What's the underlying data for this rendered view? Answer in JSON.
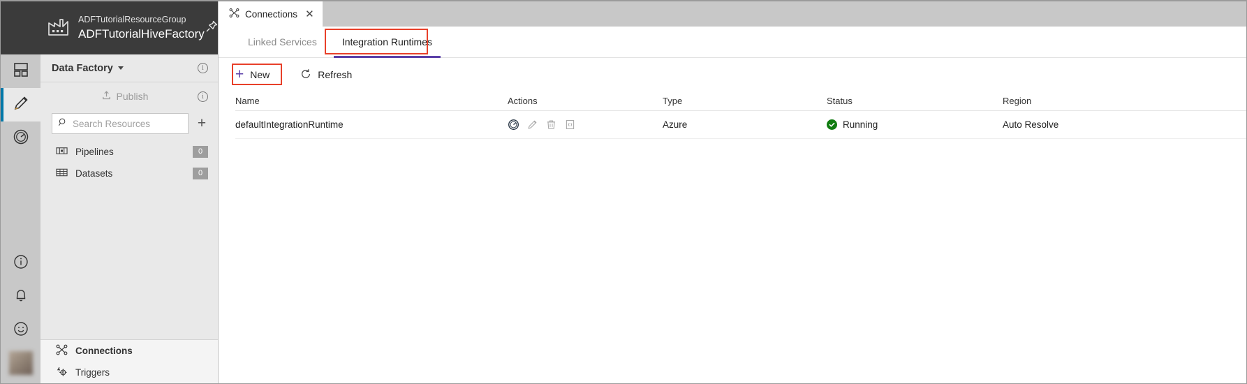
{
  "factory": {
    "resource_group": "ADFTutorialResourceGroup",
    "name": "ADFTutorialHiveFactory",
    "icon": "factory-icon",
    "pin_icon": "pin-icon"
  },
  "left_panel": {
    "title": "Data Factory",
    "title_info_icon": "info-icon",
    "publish_label": "Publish",
    "publish_icon": "upload-icon",
    "publish_info_icon": "info-icon",
    "search": {
      "placeholder": "Search Resources",
      "value": "",
      "icon": "search-icon"
    },
    "add_icon": "plus-icon",
    "items": [
      {
        "label": "Pipelines",
        "count": "0",
        "icon": "pipeline-icon"
      },
      {
        "label": "Datasets",
        "count": "0",
        "icon": "table-icon"
      }
    ],
    "bottom_items": [
      {
        "label": "Connections",
        "icon": "connections-icon",
        "selected": true
      },
      {
        "label": "Triggers",
        "icon": "trigger-icon",
        "selected": false
      }
    ]
  },
  "rail": {
    "items": [
      {
        "name": "home-icon"
      },
      {
        "name": "edit-pencil-icon"
      },
      {
        "name": "monitor-gauge-icon"
      }
    ],
    "bottom_items": [
      {
        "name": "info-icon"
      },
      {
        "name": "notifications-bell-icon"
      },
      {
        "name": "feedback-smiley-icon"
      }
    ],
    "avatar": "user-avatar"
  },
  "tabs": [
    {
      "label": "Connections",
      "icon": "connections-icon",
      "close_label": "✕",
      "active": true
    }
  ],
  "subtabs": [
    {
      "label": "Linked Services",
      "active": false
    },
    {
      "label": "Integration Runtimes",
      "active": true,
      "annotated": true
    }
  ],
  "toolbar": {
    "new_label": "New",
    "new_icon": "plus-icon",
    "new_annotated": true,
    "refresh_label": "Refresh",
    "refresh_icon": "refresh-icon"
  },
  "table": {
    "columns": [
      "Name",
      "Actions",
      "Type",
      "Status",
      "Region"
    ],
    "rows": [
      {
        "name": "defaultIntegrationRuntime",
        "actions": [
          "monitor-gauge-icon",
          "edit-pencil-icon",
          "delete-trash-icon",
          "code-json-icon"
        ],
        "type": "Azure",
        "status": "Running",
        "status_icon": "check-circle-icon",
        "region": "Auto Resolve"
      }
    ]
  },
  "colors": {
    "header_bar": "#3b3b3b",
    "accent_purple": "#5b3fa8",
    "annotation_red": "#e8402a",
    "status_green": "#107c10",
    "rail_active_blue": "#0078a8"
  }
}
